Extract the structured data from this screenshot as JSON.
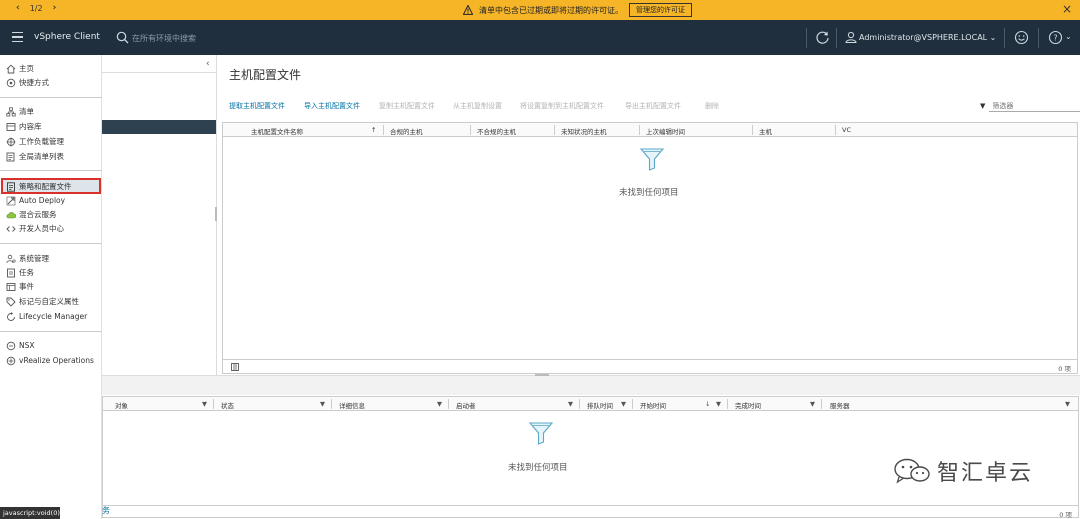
{
  "alert": {
    "pager": "1/2",
    "message": "清单中包含已过期或即将过期的许可证。",
    "button_label": "管理您的许可证"
  },
  "header": {
    "app_title": "vSphere Client",
    "search_placeholder": "在所有环境中搜索",
    "user": "Administrator@VSPHERE.LOCAL"
  },
  "sidebar": {
    "items": [
      {
        "label": "主页",
        "icon": "home-icon"
      },
      {
        "label": "快捷方式",
        "icon": "shortcuts-icon"
      },
      {
        "label": "清单",
        "icon": "inventory-icon"
      },
      {
        "label": "内容库",
        "icon": "library-icon"
      },
      {
        "label": "工作负载管理",
        "icon": "workload-icon"
      },
      {
        "label": "全局清单列表",
        "icon": "global-list-icon"
      },
      {
        "label": "策略和配置文件",
        "icon": "policies-icon"
      },
      {
        "label": "Auto Deploy",
        "icon": "auto-deploy-icon"
      },
      {
        "label": "混合云服务",
        "icon": "hybrid-cloud-icon"
      },
      {
        "label": "开发人员中心",
        "icon": "code-icon"
      },
      {
        "label": "系统管理",
        "icon": "admin-icon"
      },
      {
        "label": "任务",
        "icon": "tasks-icon"
      },
      {
        "label": "事件",
        "icon": "events-icon"
      },
      {
        "label": "标记与自定义属性",
        "icon": "tag-icon"
      },
      {
        "label": "Lifecycle Manager",
        "icon": "lifecycle-icon"
      },
      {
        "label": "NSX",
        "icon": "nsx-icon"
      },
      {
        "label": "vRealize Operations",
        "icon": "vrops-icon"
      }
    ]
  },
  "main": {
    "title": "主机配置文件",
    "toolbar": [
      {
        "label": "提取主机配置文件",
        "enabled": true
      },
      {
        "label": "导入主机配置文件",
        "enabled": true
      },
      {
        "label": "复制主机配置文件",
        "enabled": false
      },
      {
        "label": "从主机复制设置",
        "enabled": false
      },
      {
        "label": "将设置复制到主机配置文件",
        "enabled": false
      },
      {
        "label": "导出主机配置文件",
        "enabled": false
      },
      {
        "label": "删除",
        "enabled": false
      }
    ],
    "filter_placeholder": "筛选器",
    "columns": [
      "主机配置文件名称",
      "合规的主机",
      "不合规的主机",
      "未知状况的主机",
      "上次编辑时间",
      "主机",
      "VC"
    ],
    "empty_text": "未找到任何项目",
    "count": "0 项"
  },
  "tasks": {
    "columns": [
      "对象",
      "状态",
      "详细信息",
      "启动者",
      "排队时间",
      "开始时间",
      "完成时间",
      "服务器"
    ],
    "empty_text": "未找到任何项目",
    "count": "0 项",
    "tab_label": "务"
  },
  "status_bar": "javascript:void(0)",
  "watermark": "智汇卓云",
  "colors": {
    "alert_bg": "#f6b527",
    "header_bg": "#1f2f3d",
    "link": "#0072a3",
    "active_border": "#d9302c"
  }
}
